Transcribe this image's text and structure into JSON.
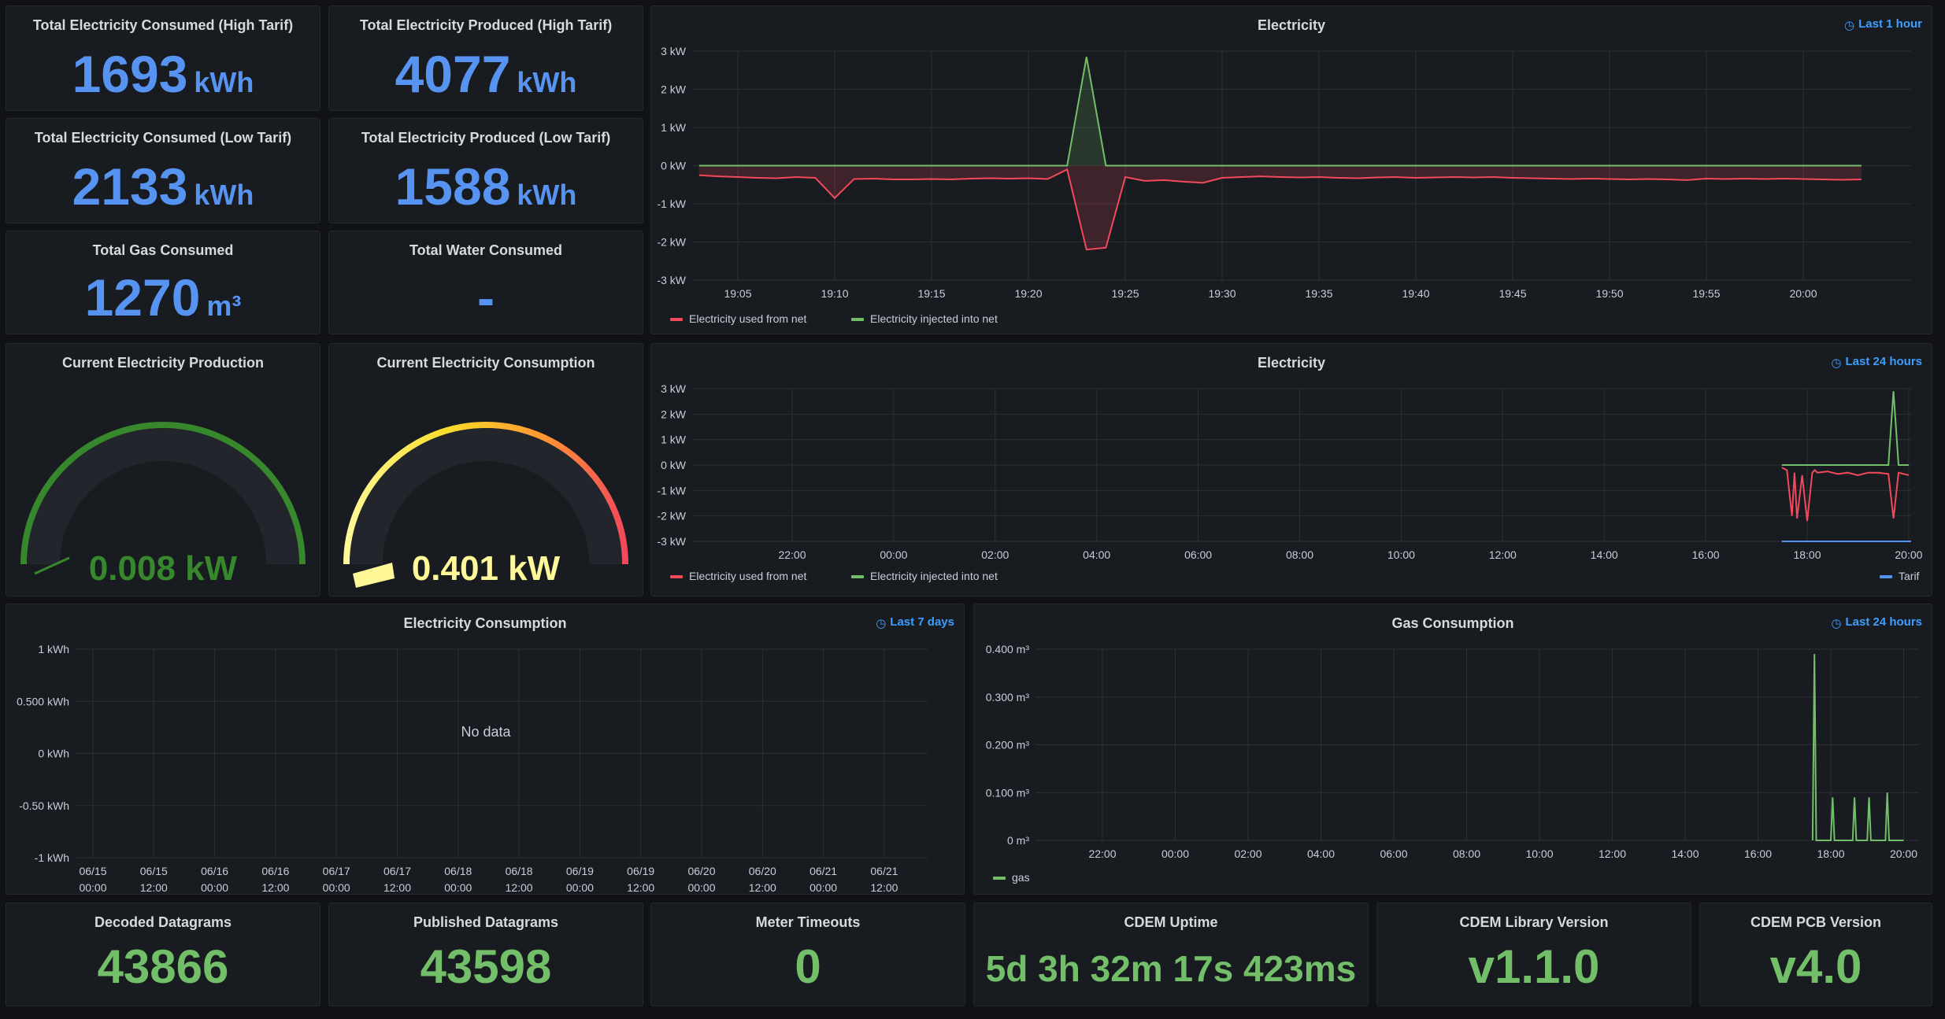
{
  "stats": {
    "consumed_high": {
      "title": "Total Electricity Consumed (High Tarif)",
      "value": "1693",
      "unit": "kWh"
    },
    "produced_high": {
      "title": "Total Electricity Produced (High Tarif)",
      "value": "4077",
      "unit": "kWh"
    },
    "consumed_low": {
      "title": "Total Electricity Consumed (Low Tarif)",
      "value": "2133",
      "unit": "kWh"
    },
    "produced_low": {
      "title": "Total Electricity Produced (Low Tarif)",
      "value": "1588",
      "unit": "kWh"
    },
    "gas": {
      "title": "Total Gas Consumed",
      "value": "1270",
      "unit": "m³"
    },
    "water": {
      "title": "Total Water Consumed",
      "value": "-"
    }
  },
  "gauges": {
    "production": {
      "title": "Current Electricity Production",
      "value": "0.008 kW",
      "fraction": 0.003,
      "color": "#37872d"
    },
    "consumption": {
      "title": "Current Electricity Consumption",
      "value": "0.401 kW",
      "fraction": 0.14,
      "color": "#fade6e"
    }
  },
  "chart_1h": {
    "title": "Electricity",
    "time_range": "Last 1 hour",
    "legend": [
      "Electricity used from net",
      "Electricity injected into net"
    ]
  },
  "chart_24h": {
    "title": "Electricity",
    "time_range": "Last 24 hours",
    "legend": [
      "Electricity used from net",
      "Electricity injected into net"
    ],
    "legend_right": "Tarif"
  },
  "consumption_panel": {
    "title": "Electricity Consumption",
    "time_range": "Last 7 days",
    "no_data": "No data"
  },
  "gas_panel": {
    "title": "Gas Consumption",
    "time_range": "Last 24 hours",
    "legend": [
      "gas"
    ]
  },
  "bottom": {
    "decoded": {
      "title": "Decoded Datagrams",
      "value": "43866"
    },
    "published": {
      "title": "Published Datagrams",
      "value": "43598"
    },
    "timeouts": {
      "title": "Meter Timeouts",
      "value": "0"
    },
    "uptime": {
      "title": "CDEM Uptime",
      "value": "5d 3h 32m 17s 423ms"
    },
    "lib": {
      "title": "CDEM Library Version",
      "value": "v1.1.0"
    },
    "pcb": {
      "title": "CDEM PCB Version",
      "value": "v4.0"
    }
  },
  "colors": {
    "used": "#f2495c",
    "injected": "#73bf69",
    "tarif": "#5794f2",
    "accent": "#3d9eff"
  },
  "chart_data": [
    {
      "type": "area",
      "title": "Electricity",
      "ylim": [
        -3,
        3
      ],
      "y_ticks": [
        "3 kW",
        "2 kW",
        "1 kW",
        "0 kW",
        "-1 kW",
        "-2 kW",
        "-3 kW"
      ],
      "x_ticks": [
        "19:05",
        "19:10",
        "19:15",
        "19:20",
        "19:25",
        "19:30",
        "19:35",
        "19:40",
        "19:45",
        "19:50",
        "19:55",
        "20:00"
      ],
      "x_minutes": [
        63,
        64,
        65,
        66,
        67,
        68,
        69,
        70,
        71,
        72,
        73,
        74,
        75,
        76,
        77,
        78,
        79,
        80,
        81,
        82,
        83,
        84,
        85,
        86,
        87,
        88,
        89,
        90,
        91,
        92,
        93,
        94,
        95,
        96,
        97,
        98,
        99,
        100,
        101,
        102,
        103,
        104,
        105,
        106,
        107,
        108,
        109,
        110,
        111,
        112,
        113,
        114,
        115,
        116,
        117,
        118,
        119,
        120,
        121,
        122,
        123
      ],
      "series": [
        {
          "name": "Electricity used from net",
          "values": [
            -0.25,
            -0.28,
            -0.3,
            -0.32,
            -0.33,
            -0.3,
            -0.32,
            -0.85,
            -0.35,
            -0.34,
            -0.36,
            -0.36,
            -0.35,
            -0.36,
            -0.34,
            -0.33,
            -0.34,
            -0.33,
            -0.35,
            -0.1,
            -2.2,
            -2.15,
            -0.3,
            -0.4,
            -0.38,
            -0.42,
            -0.45,
            -0.32,
            -0.3,
            -0.28,
            -0.3,
            -0.31,
            -0.3,
            -0.32,
            -0.33,
            -0.31,
            -0.3,
            -0.32,
            -0.31,
            -0.3,
            -0.31,
            -0.3,
            -0.32,
            -0.33,
            -0.34,
            -0.35,
            -0.34,
            -0.35,
            -0.36,
            -0.35,
            -0.36,
            -0.38,
            -0.34,
            -0.35,
            -0.34,
            -0.35,
            -0.34,
            -0.35,
            -0.36,
            -0.37,
            -0.36
          ]
        },
        {
          "name": "Electricity injected into net",
          "values": [
            0,
            0,
            0,
            0,
            0,
            0,
            0,
            0,
            0,
            0,
            0,
            0,
            0,
            0,
            0,
            0,
            0,
            0,
            0,
            0,
            2.85,
            0,
            0,
            0,
            0,
            0,
            0,
            0,
            0,
            0,
            0,
            0,
            0,
            0,
            0,
            0,
            0,
            0,
            0,
            0,
            0,
            0,
            0,
            0,
            0,
            0,
            0,
            0,
            0,
            0,
            0,
            0,
            0,
            0,
            0,
            0,
            0,
            0,
            0,
            0,
            0
          ]
        }
      ]
    },
    {
      "type": "line",
      "title": "Electricity",
      "ylim": [
        -3,
        3
      ],
      "y_ticks": [
        "3 kW",
        "2 kW",
        "1 kW",
        "0 kW",
        "-1 kW",
        "-2 kW",
        "-3 kW"
      ],
      "x_ticks": [
        "22:00",
        "00:00",
        "02:00",
        "04:00",
        "06:00",
        "08:00",
        "10:00",
        "12:00",
        "14:00",
        "16:00",
        "18:00",
        "20:00"
      ],
      "x_hours": [
        17.5,
        17.6,
        17.7,
        17.75,
        17.8,
        17.9,
        18.0,
        18.1,
        18.15,
        18.2,
        18.4,
        18.6,
        18.8,
        19.0,
        19.2,
        19.4,
        19.6,
        19.7,
        19.8,
        19.9,
        20.0
      ],
      "series": [
        {
          "name": "Electricity used from net",
          "values": [
            -0.1,
            -0.2,
            -2.0,
            -0.3,
            -2.1,
            -0.4,
            -2.2,
            -0.3,
            -0.2,
            -0.3,
            -0.25,
            -0.35,
            -0.3,
            -0.4,
            -0.3,
            -0.3,
            -0.35,
            -2.1,
            -0.3,
            -0.35,
            -0.4
          ]
        },
        {
          "name": "Electricity injected into net",
          "values": [
            0,
            0,
            0,
            0,
            0,
            0,
            0,
            0,
            0,
            0,
            0,
            0,
            0,
            0,
            0,
            0,
            0,
            2.9,
            0,
            0,
            0
          ]
        },
        {
          "name": "Tarif",
          "values": []
        }
      ]
    },
    {
      "type": "line",
      "title": "Electricity Consumption",
      "ylim": [
        -1,
        1
      ],
      "y_ticks": [
        "1 kWh",
        "0.500 kWh",
        "0 kWh",
        "-0.50 kWh",
        "-1 kWh"
      ],
      "x_ticks": [
        "06/15\n00:00",
        "06/15\n12:00",
        "06/16\n00:00",
        "06/16\n12:00",
        "06/17\n00:00",
        "06/17\n12:00",
        "06/18\n00:00",
        "06/18\n12:00",
        "06/19\n00:00",
        "06/19\n12:00",
        "06/20\n00:00",
        "06/20\n12:00",
        "06/21\n00:00",
        "06/21\n12:00"
      ],
      "series": []
    },
    {
      "type": "line",
      "title": "Gas Consumption",
      "ylim": [
        0,
        0.4
      ],
      "y_ticks": [
        "0.400 m³",
        "0.300 m³",
        "0.200 m³",
        "0.100 m³",
        "0 m³"
      ],
      "x_ticks": [
        "22:00",
        "00:00",
        "02:00",
        "04:00",
        "06:00",
        "08:00",
        "10:00",
        "12:00",
        "14:00",
        "16:00",
        "18:00",
        "20:00"
      ],
      "x_hours": [
        17.5,
        17.55,
        17.6,
        18.0,
        18.05,
        18.1,
        18.6,
        18.65,
        18.7,
        19.0,
        19.05,
        19.1,
        19.5,
        19.55,
        19.6,
        20.0
      ],
      "series": [
        {
          "name": "gas",
          "values": [
            0,
            0.39,
            0,
            0,
            0.09,
            0,
            0,
            0.09,
            0,
            0,
            0.09,
            0,
            0,
            0.1,
            0,
            0
          ]
        }
      ]
    }
  ]
}
